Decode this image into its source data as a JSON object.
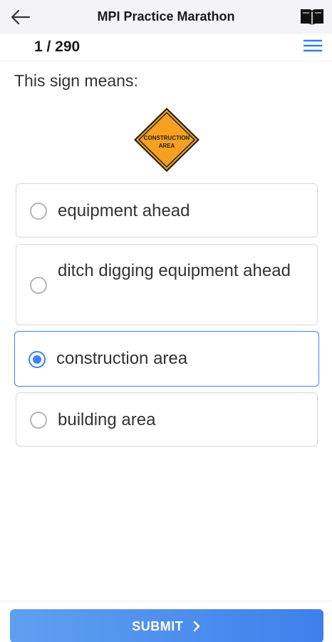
{
  "header": {
    "title": "MPI Practice Marathon",
    "back_icon": "arrow-left-icon",
    "book_icon": "book-icon"
  },
  "progress": {
    "counter": "1 / 290",
    "menu_icon": "hamburger-menu-icon"
  },
  "question": {
    "text": "This sign means:",
    "sign_text_line1": "CONSTRUCTION",
    "sign_text_line2": "AREA",
    "sign_color": "#f5a11f"
  },
  "options": [
    {
      "label": "equipment ahead",
      "selected": false
    },
    {
      "label": "ditch digging equipment ahead",
      "selected": false
    },
    {
      "label": "construction area",
      "selected": true
    },
    {
      "label": "building area",
      "selected": false
    }
  ],
  "footer": {
    "submit_label": "SUBMIT",
    "submit_icon": "chevron-right-icon"
  },
  "colors": {
    "accent": "#3b82f6",
    "header_bg": "#f4f4f6"
  }
}
